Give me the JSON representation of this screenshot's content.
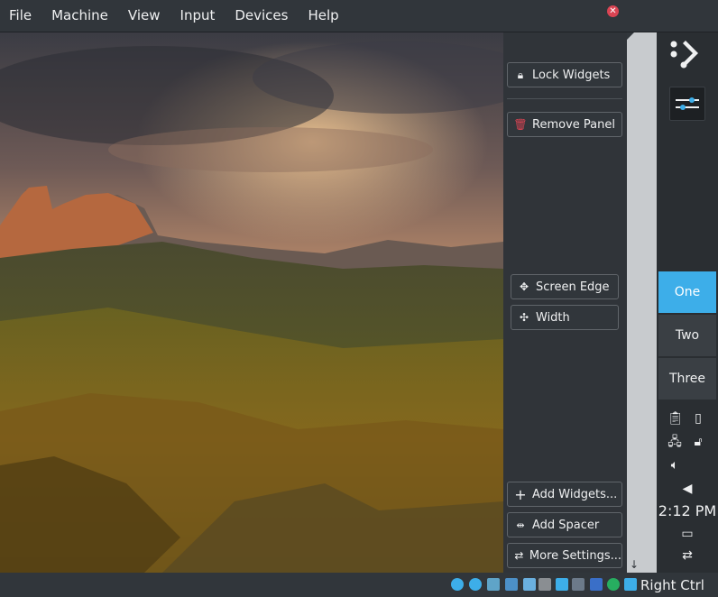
{
  "menubar": {
    "items": [
      "File",
      "Machine",
      "View",
      "Input",
      "Devices",
      "Help"
    ]
  },
  "panel_config": {
    "lock_widgets": "Lock Widgets",
    "remove_panel": "Remove Panel",
    "screen_edge": "Screen Edge",
    "width": "Width",
    "add_widgets": "Add Widgets...",
    "add_spacer": "Add Spacer",
    "more_settings": "More Settings..."
  },
  "pager": {
    "desktops": [
      "One",
      "Two",
      "Three"
    ],
    "active_index": 0
  },
  "clock": {
    "time": "2:12 PM"
  },
  "statusbar": {
    "host_key": "Right Ctrl"
  },
  "icons": {
    "close": "close-icon",
    "lock": "lock-icon",
    "trash": "trash-icon",
    "move": "move-icon",
    "resize": "resize-icon",
    "plus": "plus-icon",
    "spacer": "spacer-icon",
    "sliders": "sliders-icon"
  },
  "colors": {
    "accent": "#3daee9",
    "danger": "#da4453",
    "background": "#31363b",
    "text": "#eff0f1"
  }
}
